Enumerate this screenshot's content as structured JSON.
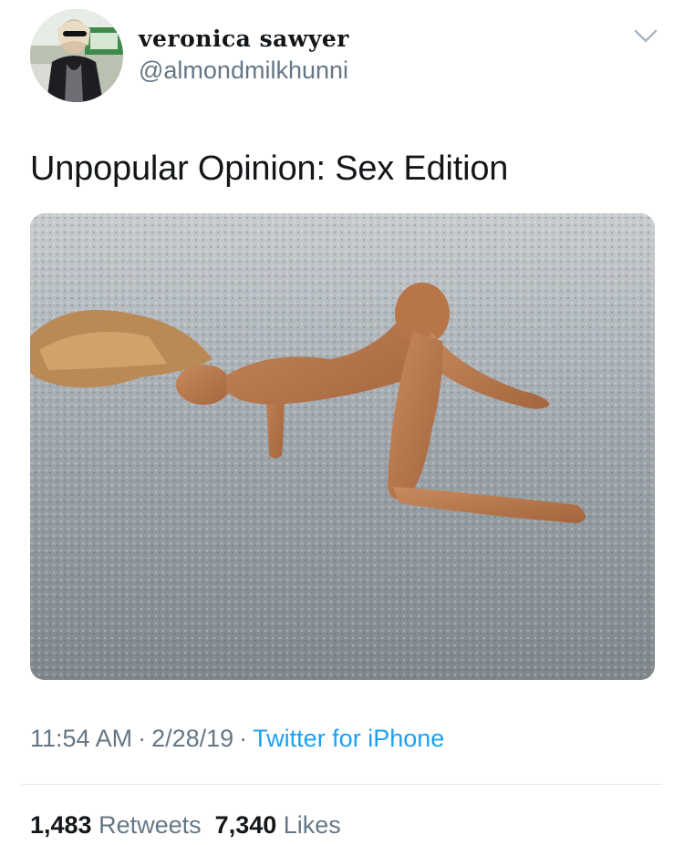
{
  "author": {
    "display_name": "veronica sawyer",
    "handle": "@almondmilkhunni"
  },
  "icons": {
    "more": "chevron-down-icon"
  },
  "tweet": {
    "text": "Unpopular Opinion: Sex Edition"
  },
  "meta": {
    "time": "11:54 AM",
    "date": "2/28/19",
    "source": "Twitter for iPhone",
    "separator": "·"
  },
  "stats": {
    "retweets_count": "1,483",
    "retweets_label": "Retweets",
    "likes_count": "7,340",
    "likes_label": "Likes"
  },
  "colors": {
    "link": "#1da1f2",
    "secondary_text": "#657786",
    "primary_text": "#14171a",
    "divider": "#e1e8ed"
  }
}
